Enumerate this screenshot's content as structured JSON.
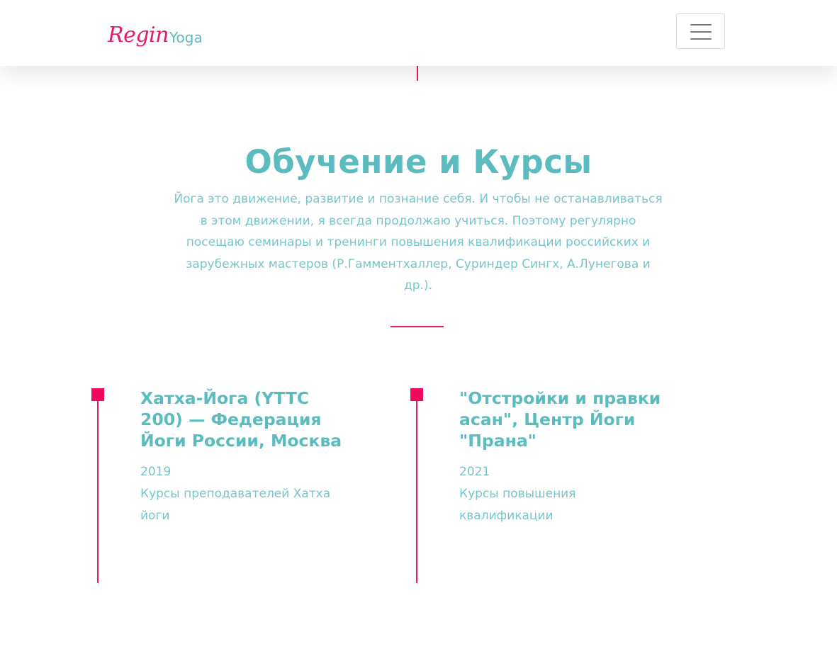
{
  "header": {
    "logo_script": "Regin",
    "logo_word": "Yoga",
    "menu_icon": "hamburger-icon"
  },
  "section": {
    "title": "Обучение и Курсы",
    "intro": "Йога это движение, развитие и познание себя. И чтобы не останавливаться в этом движении, я всегда продолжаю учиться. Поэтому регулярно посещаю семинары и тренинги повышения квалификации российских и зарубежных мастеров (Р.Гамментхаллер, Суриндер Сингх, А.Лунегова и др.)."
  },
  "courses": [
    {
      "title": "Хатха-Йога (YTTC 200) — Федерация Йоги России, Москва",
      "year": "2019",
      "description": "Курсы преподавателей Хатха йоги"
    },
    {
      "title": "\"Отстройки и правки асан\", Центр Йоги \"Прана\"",
      "year": "2021",
      "description": "Курсы повышения квалификации"
    }
  ],
  "colors": {
    "accent_pink": "#e8196b",
    "teal": "#5bbcbf",
    "teal_light": "#79c6c8"
  }
}
